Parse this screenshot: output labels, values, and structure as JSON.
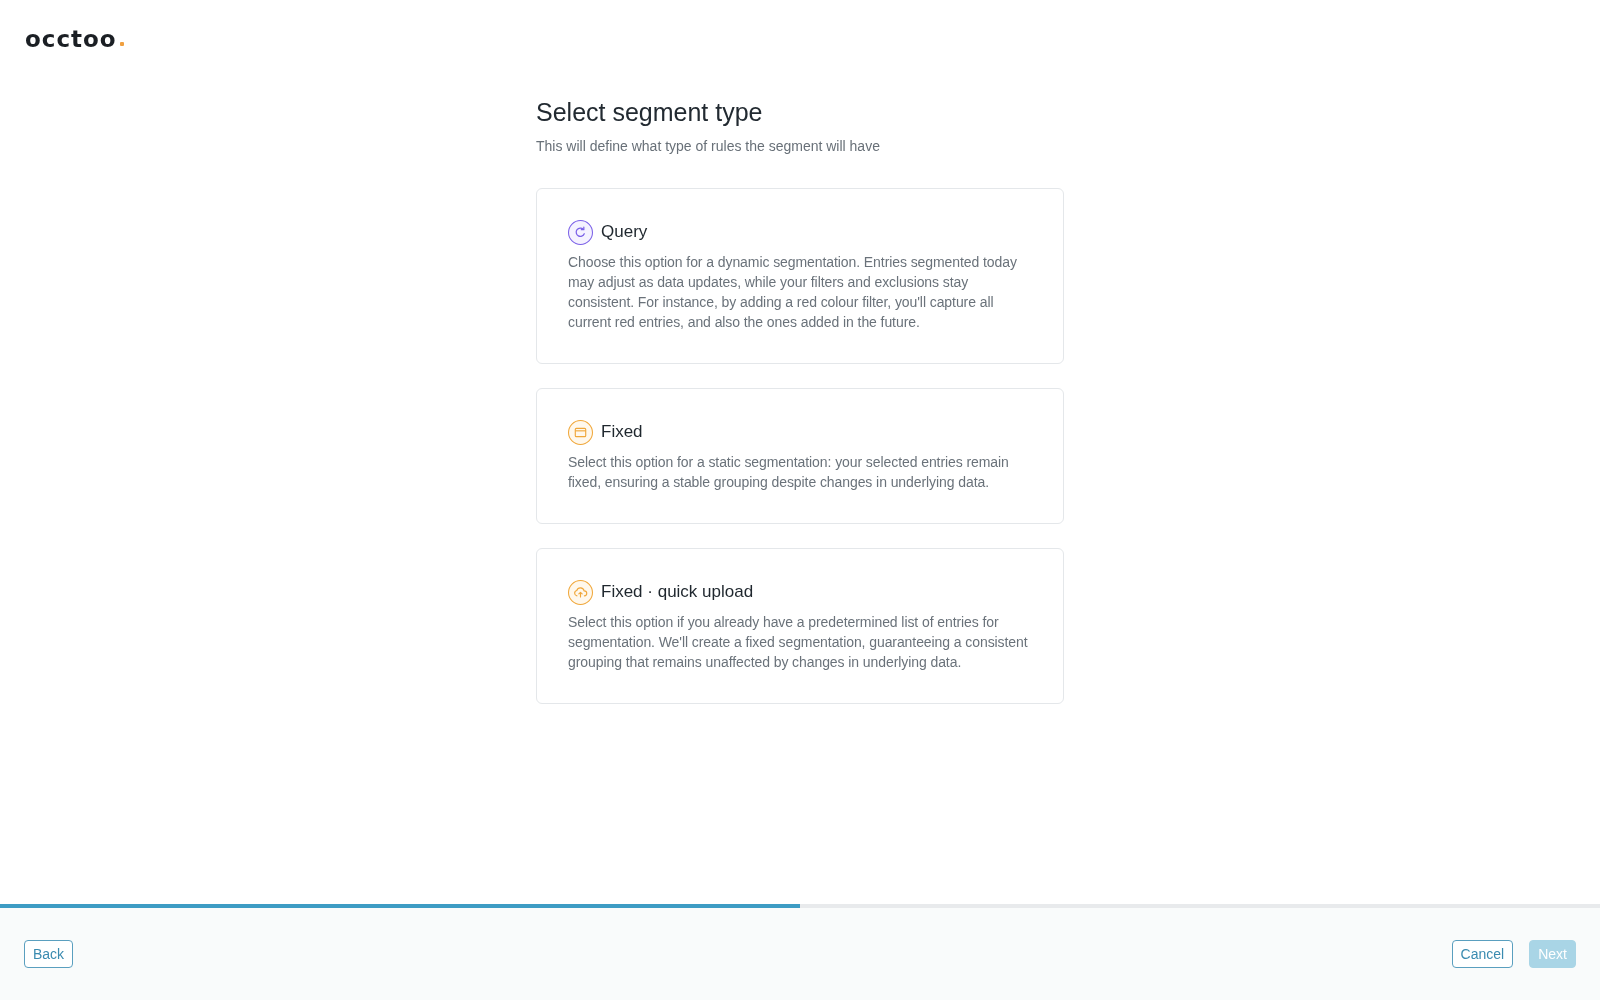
{
  "logo": {
    "text": "occtoo"
  },
  "header": {
    "title": "Select segment type",
    "subtitle": "This will define what type of rules the segment will have"
  },
  "options": [
    {
      "kind": "query",
      "title": "Query",
      "description": "Choose this option for a dynamic segmentation. Entries segmented today may adjust as data updates, while your filters and exclusions stay consistent. For instance, by adding a red colour filter, you'll capture all current red entries, and also the ones added in the future.",
      "selected": false
    },
    {
      "kind": "fixed",
      "title": "Fixed",
      "description": "Select this option for a static segmentation: your selected entries remain fixed, ensuring a stable grouping despite changes in underlying data.",
      "selected": false
    },
    {
      "kind": "upload",
      "title": "Fixed · quick upload",
      "description": "Select this option if you already have a predetermined list of entries for segmentation. We'll create a fixed segmentation, guaranteeing a consistent grouping that remains unaffected by changes in underlying data.",
      "selected": false
    }
  ],
  "progress": {
    "level": 0.5
  },
  "footer": {
    "left_buttons": [
      {
        "label": "Back",
        "kind": "outline",
        "disabled": false
      }
    ],
    "right_buttons": [
      {
        "label": "Cancel",
        "kind": "outline",
        "disabled": false
      },
      {
        "label": "Next",
        "kind": "primary",
        "disabled": true
      }
    ]
  }
}
